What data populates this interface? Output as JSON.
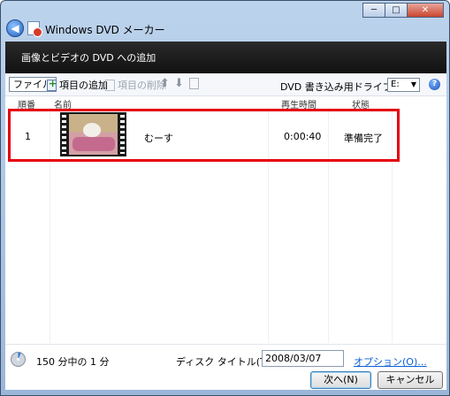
{
  "window": {
    "title": "Windows DVD メーカー",
    "controls": {
      "minimize": "─",
      "maximize": "□",
      "close": "✕"
    }
  },
  "header": {
    "title": "画像とビデオの DVD への追加"
  },
  "toolbar": {
    "file_label": "ファイル",
    "add_item_label": "項目の追加",
    "remove_item_label": "項目の削除",
    "up_icon": "up-arrow-icon",
    "down_icon": "down-arrow-icon",
    "drive_label": "DVD 書き込み用ドライブ(D):",
    "drive_value": "E:",
    "help_icon": "?"
  },
  "list": {
    "columns": [
      "順番",
      "名前",
      "再生時間",
      "状態"
    ],
    "rows": [
      {
        "order": "1",
        "name": "むーす",
        "duration": "0:00:40",
        "status": "準備完了"
      }
    ]
  },
  "status": {
    "usage_text": "150 分中の 1 分",
    "disc_title_label": "ディスク タイトル(T):",
    "disc_title_value": "2008/03/07",
    "options_link": "オプション(O)..."
  },
  "buttons": {
    "next": "次へ(N)",
    "cancel": "キャンセル"
  },
  "colors": {
    "highlight": "#e4000f",
    "link": "#0b5fd6",
    "header_band": "#111111"
  }
}
